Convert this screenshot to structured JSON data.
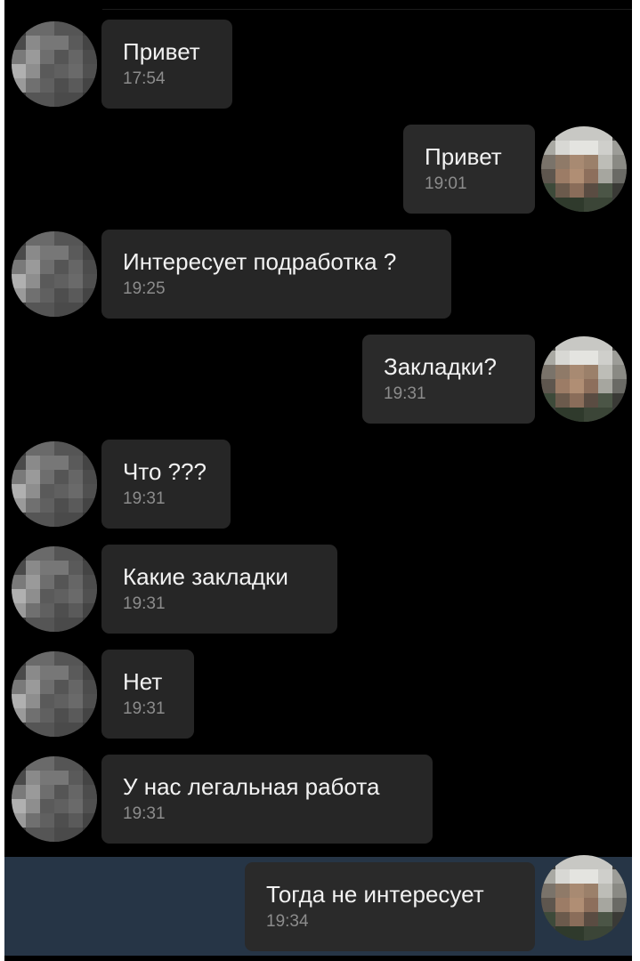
{
  "chat": {
    "messages": [
      {
        "direction": "in",
        "text": "Привет",
        "time": "17:54"
      },
      {
        "direction": "out",
        "text": "Привет",
        "time": "19:01"
      },
      {
        "direction": "in",
        "text": "Интересует подработка ?",
        "time": "19:25"
      },
      {
        "direction": "out",
        "text": "Закладки?",
        "time": "19:31"
      },
      {
        "direction": "in",
        "text": "Что ???",
        "time": "19:31"
      },
      {
        "direction": "in",
        "text": "Какие закладки",
        "time": "19:31"
      },
      {
        "direction": "in",
        "text": "Нет",
        "time": "19:31"
      },
      {
        "direction": "in",
        "text": "У нас легальная работа",
        "time": "19:31"
      },
      {
        "direction": "out",
        "text": "Тогда не интересует",
        "time": "19:34",
        "selected": true
      }
    ]
  },
  "colors": {
    "background": "#000000",
    "bubble": "#262626",
    "selection": "#263546",
    "text": "#f2f2f2",
    "time": "#8c8c8c"
  }
}
